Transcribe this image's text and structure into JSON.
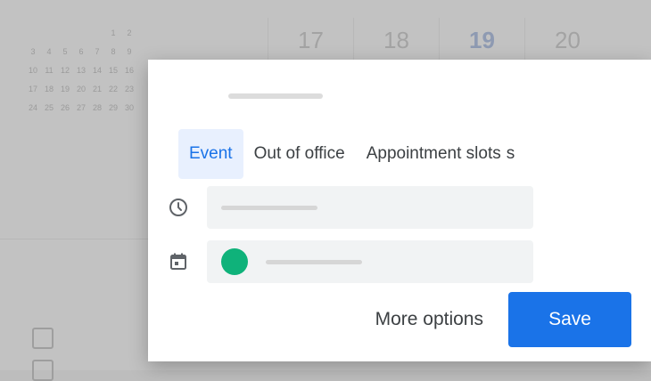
{
  "background": {
    "days": [
      "17",
      "18",
      "19",
      "20"
    ],
    "mini_calendar": [
      [
        "",
        "",
        "",
        "",
        "",
        "1",
        "2"
      ],
      [
        "3",
        "4",
        "5",
        "6",
        "7",
        "8",
        "9"
      ],
      [
        "10",
        "11",
        "12",
        "13",
        "14",
        "15",
        "16"
      ],
      [
        "17",
        "18",
        "19",
        "20",
        "21",
        "22",
        "23"
      ],
      [
        "24",
        "25",
        "26",
        "27",
        "28",
        "29",
        "30"
      ]
    ]
  },
  "dialog": {
    "tabs": [
      {
        "label": "Event",
        "active": true
      },
      {
        "label": "Out of office",
        "active": false
      },
      {
        "label": "Appointment slots",
        "active": false
      }
    ],
    "tabs_overflow": "s",
    "time_icon": "clock-icon",
    "calendar_icon": "calendar-icon",
    "calendar_color": "#0fb27a",
    "more_options_label": "More options",
    "save_label": "Save"
  },
  "colors": {
    "accent": "#1a73e8",
    "tab_active_bg": "#e8f0fe"
  }
}
